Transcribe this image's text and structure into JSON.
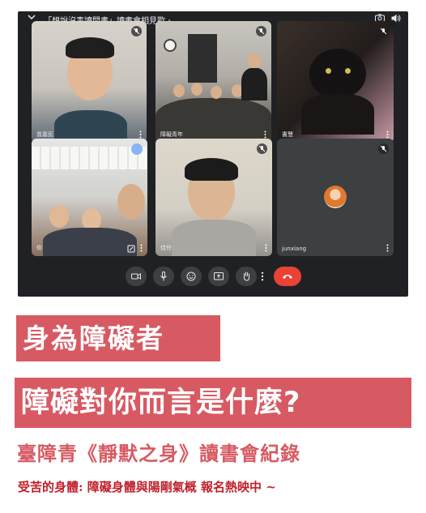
{
  "call": {
    "title": "「想說沒事讀閒書」讀書會相見歡 ›",
    "tiles": [
      {
        "name": "曾嘉民",
        "muted": true
      },
      {
        "name": "障礙青年",
        "muted": true
      },
      {
        "name": "書慧",
        "muted": true
      },
      {
        "name": "你",
        "speaking": true
      },
      {
        "name": "佳伶",
        "muted": true
      },
      {
        "name": "junxiang",
        "muted": true
      }
    ],
    "controls": [
      "camera-button",
      "mic-button",
      "emoji-button",
      "present-button",
      "raise-hand-button",
      "more-options-button",
      "end-call-button"
    ],
    "colors": {
      "background": "#202124",
      "tile": "#3c4043",
      "end_call": "#ea4335",
      "speaking": "#8ab4f8"
    }
  },
  "headline": {
    "line1": "身為障礙者",
    "line2": "障礙對你而言是什麼?",
    "color": "#d75a63"
  },
  "subtitle": "臺障青《靜默之身》讀書會紀錄",
  "tagline": "受苦的身體: 障礙身體與陽剛氣概 報名熱映中 ~"
}
